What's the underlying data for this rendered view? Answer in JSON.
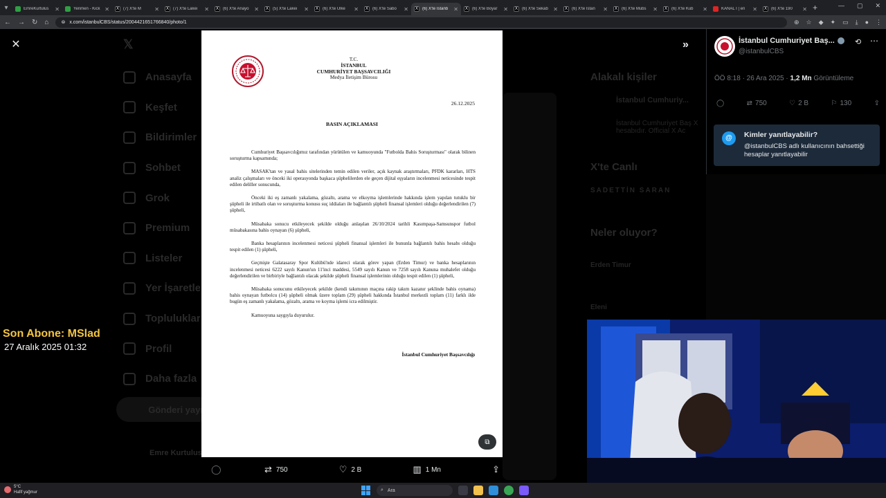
{
  "browser": {
    "tabs": [
      {
        "label": "EmreKurtulus",
        "favicon": "green"
      },
      {
        "label": "Yenmen - Kick",
        "favicon": "green"
      },
      {
        "label": "(7) X'te M",
        "favicon": "x"
      },
      {
        "label": "(7) X'te Lakei",
        "favicon": "x"
      },
      {
        "label": "(6) X'te Anayo",
        "favicon": "x"
      },
      {
        "label": "(5) X'te Lakei",
        "favicon": "x"
      },
      {
        "label": "(6) X'te Ulke",
        "favicon": "x"
      },
      {
        "label": "(6) X'te Sabo",
        "favicon": "x"
      },
      {
        "label": "(6) X'te İstanb",
        "favicon": "x",
        "active": true
      },
      {
        "label": "(6) X'te Boyar",
        "favicon": "x"
      },
      {
        "label": "(6) X'te Sekab",
        "favicon": "x"
      },
      {
        "label": "(6) X'te İstan",
        "favicon": "x"
      },
      {
        "label": "(6) X'te Mubs",
        "favicon": "x"
      },
      {
        "label": "(6) X'te Kub",
        "favicon": "x"
      },
      {
        "label": "KANAL İ | en",
        "favicon": "red"
      },
      {
        "label": "(6) X'te 190",
        "favicon": "x"
      }
    ],
    "url": "x.com/istanbulCBS/status/2004421651766840/photo/1"
  },
  "x_nav": {
    "items": [
      "Anasayfa",
      "Keşfet",
      "Bildirimler",
      "Sohbet",
      "Grok",
      "Premium",
      "Listeler",
      "Yer İşaretleri",
      "Topluluklar",
      "Profil",
      "Daha fazla"
    ],
    "post_button": "Gönderi yayınla",
    "account_name": "Emre Kurtulus"
  },
  "x_side": {
    "related_title": "Alakalı kişiler",
    "related_name": "İstanbul Cumhuriy...",
    "related_bio": "İstanbul Cumhuriyet Baş X hesabıdır. Official X Ac",
    "live_title": "X'te Canlı",
    "live_name": "SADETTİN SARAN",
    "trending_title": "Neler oluyor?",
    "trend_1": "Erden Timur",
    "trend_2": "Eleni"
  },
  "document": {
    "header_line1": "T.C.",
    "header_line2": "İSTANBUL",
    "header_line3": "CUMHURİYET BAŞSAVCILIĞI",
    "header_line4": "Medya İletişim Bürosu",
    "date": "26.12.2025",
    "title": "BASIN AÇIKLAMASI",
    "paragraphs": [
      "Cumhuriyet Başsavcılığımız tarafından yürütülen ve kamuoyunda \"Futbolda Bahis Soruşturması\" olarak bilinen soruşturma kapsamında;",
      "MASAK'tan ve yasal bahis sitelerinden temin edilen veriler, açık kaynak araştırmaları, PFDK kararları, HTS analiz çalışmaları ve önceki iki operasyonda başkaca şüphelilerden ele geçen dijital eşyaların incelenmesi neticesinde tespit edilen deliller sonucunda,",
      "Önceki iki eş zamanlı yakalama, gözaltı, arama ve elkoyma işlemlerinde hakkında işlem yapılan tutuklu bir şüpheli ile irtibatlı olan ve soruşturma konusu suç iddiaları ile bağlantılı şüpheli finansal işlemleri olduğu değerlendirilen (7) şüpheli,",
      "Müsabaka sonucu etkileyecek şekilde olduğu anlaşılan 26/10/2024 tarihli Kasımpaşa-Samsunspor futbol müsabakasına bahis oynayan (6) şüpheli,",
      "Banka hesaplarının incelenmesi neticesi şüpheli finansal işlemleri ile bununla bağlantılı bahis hesabı olduğu tespit edilen (1) şüpheli,",
      "Geçmişte Galatasaray Spor Kulübü'nde idareci olarak görev yapan (Erden Timur) ve banka hesaplarının incelenmesi neticesi 6222 sayılı Kanun'un 11'inci maddesi, 5549 sayılı Kanun ve 7258 sayılı Kanuna muhalefet olduğu değerlendirilen ve birbiriyle bağlantılı olacak şekilde şüpheli finansal işlemlerinin olduğu tespit edilen (1) şüpheli,",
      "Müsabaka sonucunu etkileyecek şekilde (kendi takımının maçına rakip takım kazanır şeklinde bahis oynama) bahis oynayan futbolcu (14) şüpheli olmak üzere toplam (29) şüpheli hakkında İstanbul merkezli toplam (11) farklı ilde bugün eş zamanlı yakalama, gözaltı, arama ve koyma işlemi icra edilmiştir.",
      "Kamuoyuna saygıyla duyurulur."
    ],
    "signature": "İstanbul Cumhuriyet Başsavcılığı"
  },
  "actions": {
    "retweets": "750",
    "likes": "2 B",
    "views": "1 Mn"
  },
  "panel": {
    "name": "İstanbul Cumhuriyet Baş...",
    "handle": "@istanbulCBS",
    "time": "ÖÖ 8:18 · 26 Ara 2025 · ",
    "views_count": "1,2 Mn",
    "views_label": " Görüntüleme",
    "retweets": "750",
    "likes": "2 B",
    "bookmarks": "130",
    "who_title": "Kimler yanıtlayabilir?",
    "who_text": "@istanbulCBS adlı kullanıcının bahsettiği hesaplar yanıtlayabilir"
  },
  "stream_overlay": {
    "sub_label": "Son Abone: MSlad",
    "sub_date": "27 Aralık 2025   01:32"
  },
  "taskbar": {
    "temp": "5°C",
    "weather": "Hafif yağmur",
    "search": "Ara"
  },
  "colors": {
    "accent": "#1d9bf0",
    "sub_label": "#f4c542",
    "cam_bg": "#0a1a5a"
  }
}
